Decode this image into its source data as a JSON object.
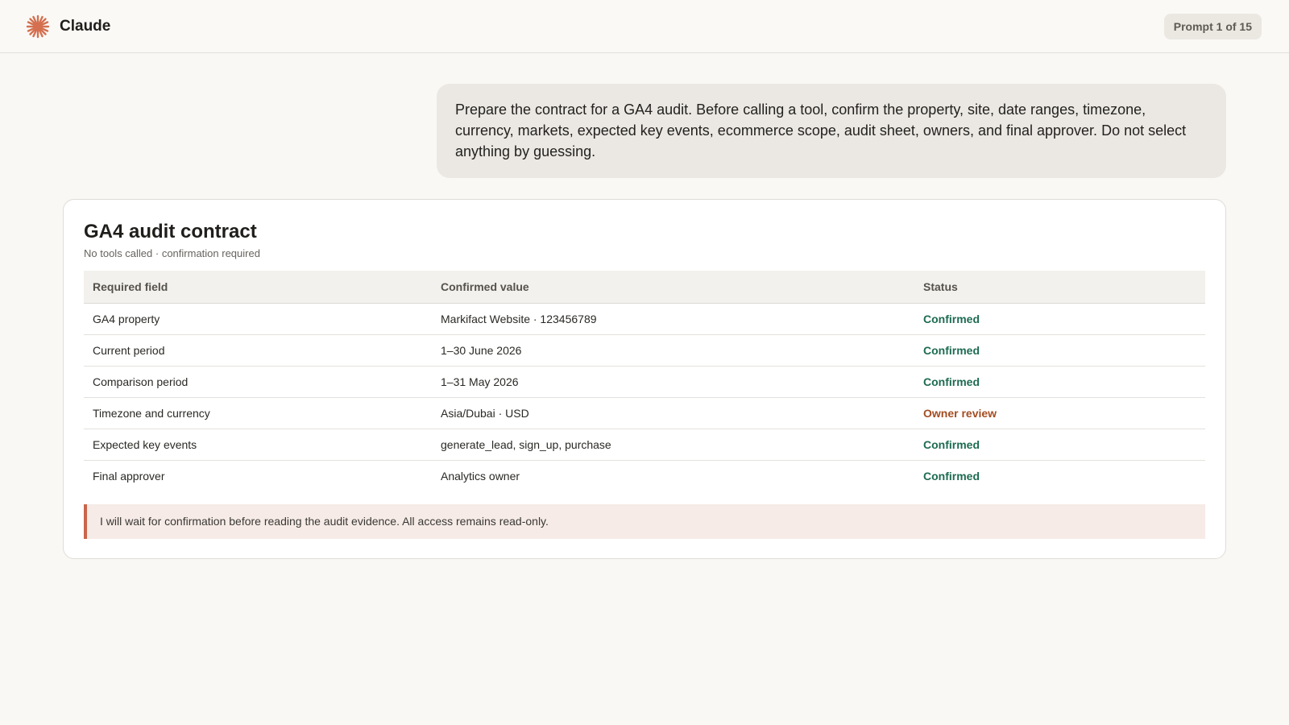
{
  "app": {
    "name": "Claude",
    "prompt_counter": "Prompt 1 of 15",
    "brand_color": "#d4704f"
  },
  "user_message": {
    "text": "Prepare the contract for a GA4 audit. Before calling a tool, confirm the property, site, date ranges, timezone, currency, markets, expected key events, ecommerce scope, audit sheet, owners, and final approver. Do not select anything by guessing."
  },
  "contract": {
    "title": "GA4 audit contract",
    "subtitle": "No tools called · confirmation required",
    "columns": {
      "field": "Required field",
      "value": "Confirmed value",
      "status": "Status"
    },
    "rows": [
      {
        "field": "GA4 property",
        "value": "Markifact Website · 123456789",
        "status": "Confirmed",
        "status_type": "confirmed"
      },
      {
        "field": "Current period",
        "value": "1–30 June 2026",
        "status": "Confirmed",
        "status_type": "confirmed"
      },
      {
        "field": "Comparison period",
        "value": "1–31 May 2026",
        "status": "Confirmed",
        "status_type": "confirmed"
      },
      {
        "field": "Timezone and currency",
        "value": "Asia/Dubai · USD",
        "status": "Owner review",
        "status_type": "review"
      },
      {
        "field": "Expected key events",
        "value": "generate_lead, sign_up, purchase",
        "status": "Confirmed",
        "status_type": "confirmed"
      },
      {
        "field": "Final approver",
        "value": "Analytics owner",
        "status": "Confirmed",
        "status_type": "confirmed"
      }
    ],
    "note": "I will wait for confirmation before reading the audit evidence. All access remains read-only.",
    "status_colors": {
      "confirmed": "#1d6b52",
      "review": "#a34d22"
    }
  }
}
